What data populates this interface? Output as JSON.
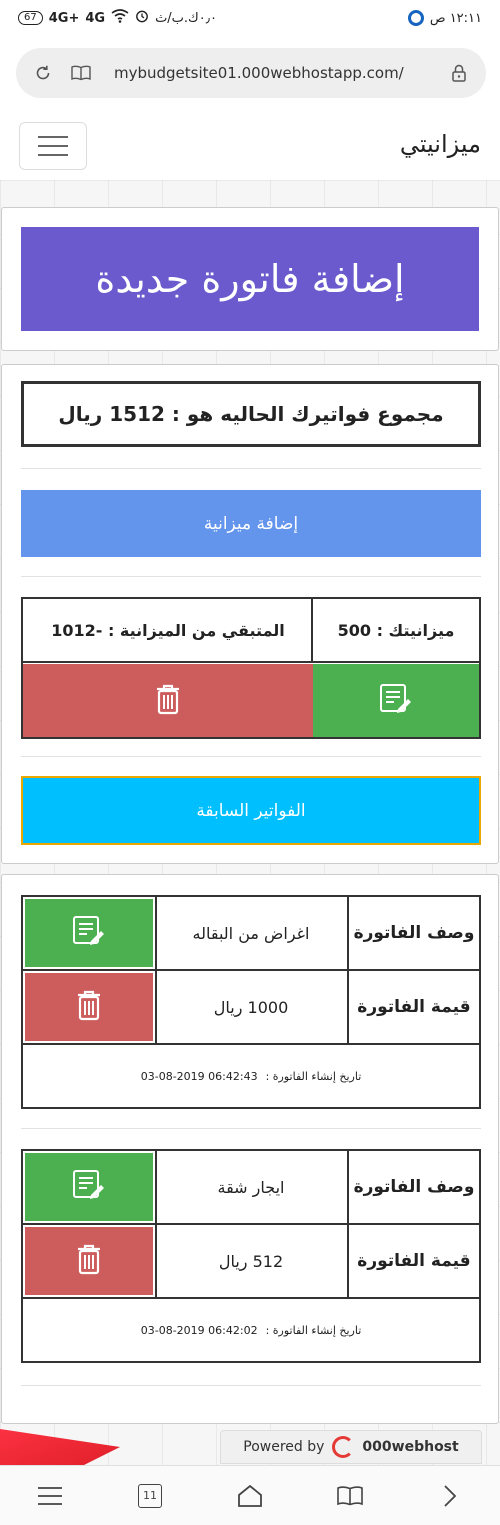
{
  "status_bar": {
    "time": "١٢:١١ ص",
    "network_left": "٠٫٠ك.ب/ث",
    "battery": "67",
    "signal1": "4G+",
    "signal2": "4G"
  },
  "browser": {
    "url": "mybudgetsite01.000webhostapp.com/"
  },
  "navbar": {
    "brand": "ميزانيتي"
  },
  "add_invoice": {
    "label": "إضافة فاتورة جديدة"
  },
  "summary": {
    "total_text": "مجموع فواتيرك الحاليه هو :  1512 ريال",
    "add_budget_label": "إضافة ميزانية",
    "budget_text": "ميزانيتك :   500",
    "remaining_text": "المتبقي من الميزانية :  -1012",
    "previous_invoices_label": "الفواتير السابقة"
  },
  "invoices": [
    {
      "desc_label": "وصف الفاتورة",
      "desc_value": "اغراض من البقاله",
      "amount_label": "قيمة الفاتورة",
      "amount_value": "1000 ريال",
      "date_label": "تاريخ إنشاء الفاتورة :",
      "date_value": "03-08-2019 06:42:43"
    },
    {
      "desc_label": "وصف الفاتورة",
      "desc_value": "ايجار شقة",
      "amount_label": "قيمة الفاتورة",
      "amount_value": "512 ريال",
      "date_label": "تاريخ إنشاء الفاتورة :",
      "date_value": "03-08-2019 06:42:02"
    }
  ],
  "footer": {
    "powered_by": "Powered by",
    "host_name": "000webhost"
  },
  "bottom_nav": {
    "tab_count": "11"
  },
  "colors": {
    "add_invoice_bg": "#6a5acd",
    "add_budget_bg": "#6495ed",
    "edit_green": "#4caf50",
    "delete_red": "#cd5c5c",
    "previous_bg": "#00bfff"
  }
}
